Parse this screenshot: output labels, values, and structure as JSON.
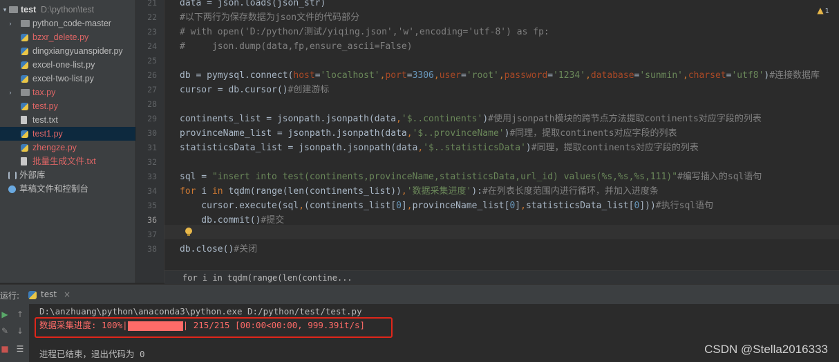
{
  "project_tree": {
    "root_name": "test",
    "root_path": "D:\\python\\test",
    "items": [
      {
        "label": "python_code-master",
        "type": "folder",
        "color": "normal"
      },
      {
        "label": "bzxr_delete.py",
        "type": "py",
        "color": "red"
      },
      {
        "label": "dingxiangyuanspider.py",
        "type": "py",
        "color": "normal"
      },
      {
        "label": "excel-one-list.py",
        "type": "py",
        "color": "normal"
      },
      {
        "label": "excel-two-list.py",
        "type": "py",
        "color": "normal"
      },
      {
        "label": "tax.py",
        "type": "folder",
        "color": "red"
      },
      {
        "label": "test.py",
        "type": "py",
        "color": "red"
      },
      {
        "label": "test.txt",
        "type": "txt",
        "color": "normal"
      },
      {
        "label": "test1.py",
        "type": "py",
        "color": "red"
      },
      {
        "label": "zhengze.py",
        "type": "py",
        "color": "red"
      },
      {
        "label": "批量生成文件.txt",
        "type": "txt",
        "color": "red"
      }
    ],
    "external_libraries": "外部库",
    "scratches": "草稿文件和控制台"
  },
  "editor": {
    "line_numbers": [
      "21",
      "22",
      "23",
      "24",
      "25",
      "26",
      "27",
      "28",
      "29",
      "30",
      "31",
      "32",
      "33",
      "34",
      "35",
      "36",
      "37",
      "38"
    ],
    "current_line": "36",
    "warning_count": "1",
    "lines": [
      [
        {
          "t": "data = json.loads(json_str)",
          "c": "plain"
        }
      ],
      [
        {
          "t": "#以下两行为保存数据为json文件的代码部分",
          "c": "cmt"
        }
      ],
      [
        {
          "t": "# with open('D:/python/测试/yiqing.json','w',encoding='utf-8') as fp:",
          "c": "cmt"
        }
      ],
      [
        {
          "t": "#     json.dump(data,fp,ensure_ascii=False)",
          "c": "cmt"
        }
      ],
      [],
      [
        {
          "t": "db = pymysql.connect(",
          "c": "plain"
        },
        {
          "t": "host",
          "c": "param"
        },
        {
          "t": "=",
          "c": "plain"
        },
        {
          "t": "'localhost'",
          "c": "str"
        },
        {
          "t": ",",
          "c": "sep"
        },
        {
          "t": "port",
          "c": "param"
        },
        {
          "t": "=",
          "c": "plain"
        },
        {
          "t": "3306",
          "c": "num"
        },
        {
          "t": ",",
          "c": "sep"
        },
        {
          "t": "user",
          "c": "param"
        },
        {
          "t": "=",
          "c": "plain"
        },
        {
          "t": "'root'",
          "c": "str"
        },
        {
          "t": ",",
          "c": "sep"
        },
        {
          "t": "password",
          "c": "param"
        },
        {
          "t": "=",
          "c": "plain"
        },
        {
          "t": "'1234'",
          "c": "str"
        },
        {
          "t": ",",
          "c": "sep"
        },
        {
          "t": "database",
          "c": "param"
        },
        {
          "t": "=",
          "c": "plain"
        },
        {
          "t": "'sunmin'",
          "c": "str"
        },
        {
          "t": ",",
          "c": "sep"
        },
        {
          "t": "charset",
          "c": "param"
        },
        {
          "t": "=",
          "c": "plain"
        },
        {
          "t": "'utf8'",
          "c": "str"
        },
        {
          "t": ")",
          "c": "plain"
        },
        {
          "t": "#连接数据库",
          "c": "cmt"
        }
      ],
      [
        {
          "t": "cursor = db.cursor()",
          "c": "plain"
        },
        {
          "t": "#创建游标",
          "c": "cmt"
        }
      ],
      [],
      [
        {
          "t": "continents_list = jsonpath.jsonpath(data",
          "c": "plain"
        },
        {
          "t": ",",
          "c": "sep"
        },
        {
          "t": "'$..continents'",
          "c": "str"
        },
        {
          "t": ")",
          "c": "plain"
        },
        {
          "t": "#使用jsonpath模块的跨节点方法提取continents对应字段的列表",
          "c": "cmt"
        }
      ],
      [
        {
          "t": "provinceName_list = jsonpath.jsonpath(data",
          "c": "plain"
        },
        {
          "t": ",",
          "c": "sep"
        },
        {
          "t": "'$..provinceName'",
          "c": "str"
        },
        {
          "t": ")",
          "c": "plain"
        },
        {
          "t": "#同理，提取continents对应字段的列表",
          "c": "cmt"
        }
      ],
      [
        {
          "t": "statisticsData_list = jsonpath.jsonpath(data",
          "c": "plain"
        },
        {
          "t": ",",
          "c": "sep"
        },
        {
          "t": "'$..statisticsData'",
          "c": "str"
        },
        {
          "t": ")",
          "c": "plain"
        },
        {
          "t": "#同理，提取continents对应字段的列表",
          "c": "cmt"
        }
      ],
      [],
      [
        {
          "t": "sql = ",
          "c": "plain"
        },
        {
          "t": "\"insert into test(continents,provinceName,statisticsData,url_id) values(%s,%s,%s,111)\"",
          "c": "str"
        },
        {
          "t": "#编写插入的sql语句",
          "c": "cmt"
        }
      ],
      [
        {
          "t": "for ",
          "c": "kw"
        },
        {
          "t": "i ",
          "c": "plain"
        },
        {
          "t": "in ",
          "c": "kw"
        },
        {
          "t": "tqdm(range(len(continents_list))",
          "c": "plain"
        },
        {
          "t": ",",
          "c": "sep"
        },
        {
          "t": "'数据采集进度'",
          "c": "str"
        },
        {
          "t": "):",
          "c": "plain"
        },
        {
          "t": "#在列表长度范围内进行循环，并加入进度条",
          "c": "cmt"
        }
      ],
      [
        {
          "t": "    cursor.execute(sql",
          "c": "plain"
        },
        {
          "t": ",",
          "c": "sep"
        },
        {
          "t": "(continents_list[",
          "c": "plain"
        },
        {
          "t": "0",
          "c": "num"
        },
        {
          "t": "]",
          "c": "plain"
        },
        {
          "t": ",",
          "c": "sep"
        },
        {
          "t": "provinceName_list[",
          "c": "plain"
        },
        {
          "t": "0",
          "c": "num"
        },
        {
          "t": "]",
          "c": "plain"
        },
        {
          "t": ",",
          "c": "sep"
        },
        {
          "t": "statisticsData_list[",
          "c": "plain"
        },
        {
          "t": "0",
          "c": "num"
        },
        {
          "t": "]))",
          "c": "plain"
        },
        {
          "t": "#执行sql语句",
          "c": "cmt"
        }
      ],
      [
        {
          "t": "    db.commit()",
          "c": "plain"
        },
        {
          "t": "#提交",
          "c": "cmt"
        }
      ],
      [],
      [
        {
          "t": "db.close()",
          "c": "plain"
        },
        {
          "t": "#关闭",
          "c": "cmt"
        }
      ]
    ],
    "breadcrumb": "for i in tqdm(range(len(contine..."
  },
  "run_panel": {
    "label": "运行:",
    "tab_name": "test",
    "command": "D:\\anzhuang\\python\\anaconda3\\python.exe D:/python/test/test.py",
    "progress_prefix": "数据采集进度: 100%|",
    "progress_fraction": 1.0,
    "progress_suffix": "| 215/215 [00:00<00:00, 999.39it/s]",
    "exit_message": "进程已结束，退出代码为 0"
  },
  "watermark": "CSDN @Stella2016333",
  "colors": {
    "accent_red": "#e0261a",
    "progress_red": "#ff6b68"
  }
}
